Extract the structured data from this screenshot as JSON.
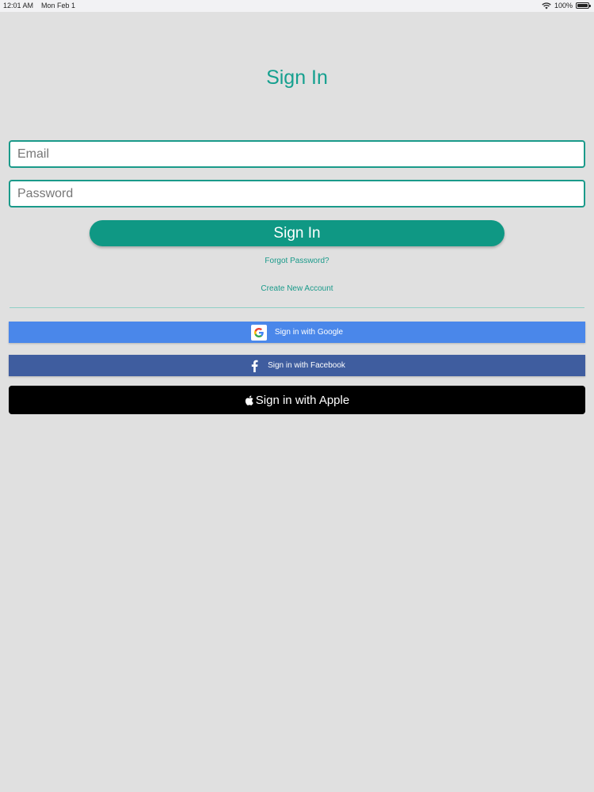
{
  "status_bar": {
    "time": "12:01 AM",
    "date": "Mon Feb 1",
    "battery": "100%"
  },
  "page": {
    "title": "Sign In"
  },
  "form": {
    "email_placeholder": "Email",
    "password_placeholder": "Password",
    "signin_label": "Sign In",
    "forgot_label": "Forgot Password?",
    "create_label": "Create New Account"
  },
  "social": {
    "google_label": "Sign in with Google",
    "facebook_label": "Sign in with Facebook",
    "apple_label": "Sign in with Apple"
  },
  "colors": {
    "accent": "#0f9884",
    "google": "#4a87ea",
    "facebook": "#3f5d9f",
    "apple": "#000000",
    "background": "#e0e0e0"
  },
  "icons": [
    "wifi-icon",
    "battery-icon",
    "google-icon",
    "facebook-icon",
    "apple-icon"
  ]
}
